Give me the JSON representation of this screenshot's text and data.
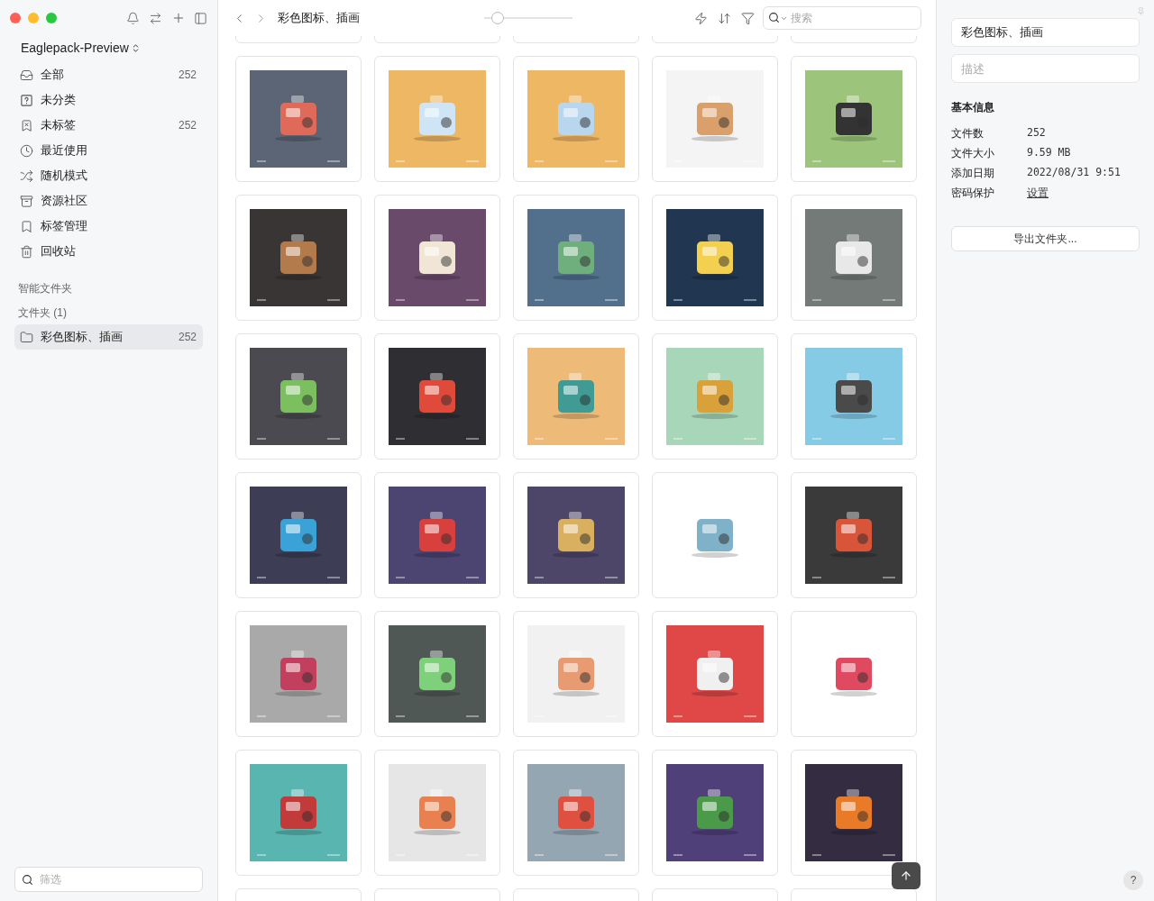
{
  "sidebar": {
    "library": "Eaglepack-Preview",
    "items": [
      {
        "label": "全部",
        "count": "252",
        "selected": false
      },
      {
        "label": "未分类",
        "selected": false
      },
      {
        "label": "未标签",
        "count": "252",
        "selected": false
      },
      {
        "label": "最近使用",
        "selected": false
      },
      {
        "label": "随机模式",
        "selected": false
      },
      {
        "label": "资源社区",
        "selected": false
      },
      {
        "label": "标签管理",
        "selected": false
      },
      {
        "label": "回收站",
        "selected": false
      }
    ],
    "smart_folders_heading": "智能文件夹",
    "folders_heading": "文件夹 (1)",
    "folders": [
      {
        "label": "彩色图标、插画",
        "count": "252",
        "selected": true
      }
    ],
    "filter": {
      "placeholder": "筛选"
    }
  },
  "toolbar": {
    "breadcrumb": "彩色图标、插画",
    "zoom_slider": {
      "level": 0.08
    },
    "search": {
      "placeholder": "搜索"
    }
  },
  "inspector": {
    "name": "彩色图标、插画",
    "description": {
      "placeholder": "描述"
    },
    "section_title": "基本信息",
    "rows": [
      {
        "label": "文件数",
        "value": "252",
        "kind": "text"
      },
      {
        "label": "文件大小",
        "value": "9.59 MB",
        "kind": "text"
      },
      {
        "label": "添加日期",
        "value": "2022/08/31 9:51",
        "kind": "text"
      },
      {
        "label": "密码保护",
        "value": "设置",
        "kind": "link"
      }
    ],
    "export_button": "导出文件夹...",
    "help": "?"
  }
}
